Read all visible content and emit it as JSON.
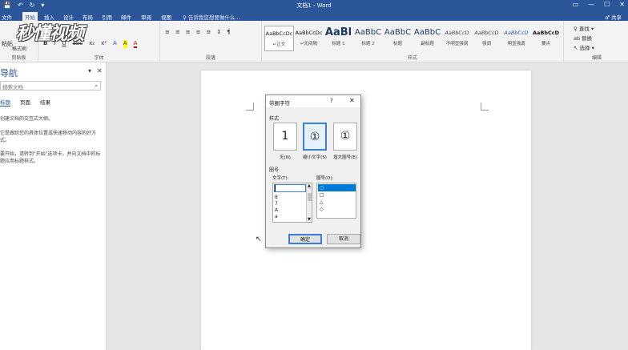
{
  "titlebar": {
    "title": "文档1 - Word",
    "qat": [
      "💾",
      "↶",
      "↻",
      "▾"
    ],
    "win": [
      "▭",
      "—",
      "☐",
      "✕"
    ]
  },
  "tabs": [
    "文件",
    "开始",
    "插入",
    "设计",
    "布局",
    "引用",
    "邮件",
    "审阅",
    "视图"
  ],
  "tellme": "♀ 告诉我您想要做什么...",
  "share": "♂ 共享",
  "watermark": "秒懂视频",
  "ribbon": {
    "groups": {
      "clipboard": "剪贴板",
      "font": "字体",
      "paragraph": "段落",
      "styles": "样式",
      "editing": "编辑"
    },
    "paste": "粘贴",
    "format_painter": "格式刷",
    "font_btns": [
      "B",
      "I",
      "U",
      "abc",
      "x₂",
      "x²",
      "A",
      "A",
      "A"
    ],
    "para_btns": [
      "≡",
      "≡",
      "≡",
      "≡",
      "≡",
      "↕",
      "¶"
    ],
    "styles": [
      {
        "sample": "AaBbCcDc",
        "name": "↵正文"
      },
      {
        "sample": "AaBbCcDc",
        "name": "↵无间隔"
      },
      {
        "sample": "AaBl",
        "name": "标题 1"
      },
      {
        "sample": "AaBbC",
        "name": "标题 2"
      },
      {
        "sample": "AaBbC",
        "name": "标题"
      },
      {
        "sample": "AaBbC",
        "name": "副标题"
      },
      {
        "sample": "AaBbCcD",
        "name": "不明显强调"
      },
      {
        "sample": "AaBbCcD",
        "name": "强调"
      },
      {
        "sample": "AaBbCcD",
        "name": "明显强调"
      },
      {
        "sample": "AaBbCcD",
        "name": "要点"
      }
    ],
    "editing": [
      "♀ 查找 ▾",
      "ab 替换",
      "↖ 选择 ▾"
    ]
  },
  "nav": {
    "title": "导航",
    "close": "✕",
    "dropdown": "▾",
    "search_placeholder": "搜索文档",
    "search_icon": "⌕",
    "tabs": [
      "标题",
      "页面",
      "结果"
    ],
    "lines": [
      "创建文档的交互式大纲。",
      "它是跟踪您的具体位置或快速移动内容的好方式。",
      "要开始，请转到\"开始\"选项卡，并向文档中的标题应用标题样式。"
    ]
  },
  "dialog": {
    "title": "带圈字符",
    "help": "?",
    "close": "✕",
    "style_label": "样式",
    "styles": [
      {
        "glyph": "1",
        "label": "无(N)"
      },
      {
        "glyph": "①",
        "label": "缩小文字(S)"
      },
      {
        "glyph": "①",
        "label": "增大圈号(E)"
      }
    ],
    "encl_label": "圈号",
    "text_label": "文字(T):",
    "encl_list_label": "圈号(O):",
    "text_options": [
      "8",
      "7",
      "A",
      "a"
    ],
    "encl_options": [
      "○",
      "□",
      "△",
      "◇"
    ],
    "ok": "确定",
    "cancel": "取消"
  }
}
